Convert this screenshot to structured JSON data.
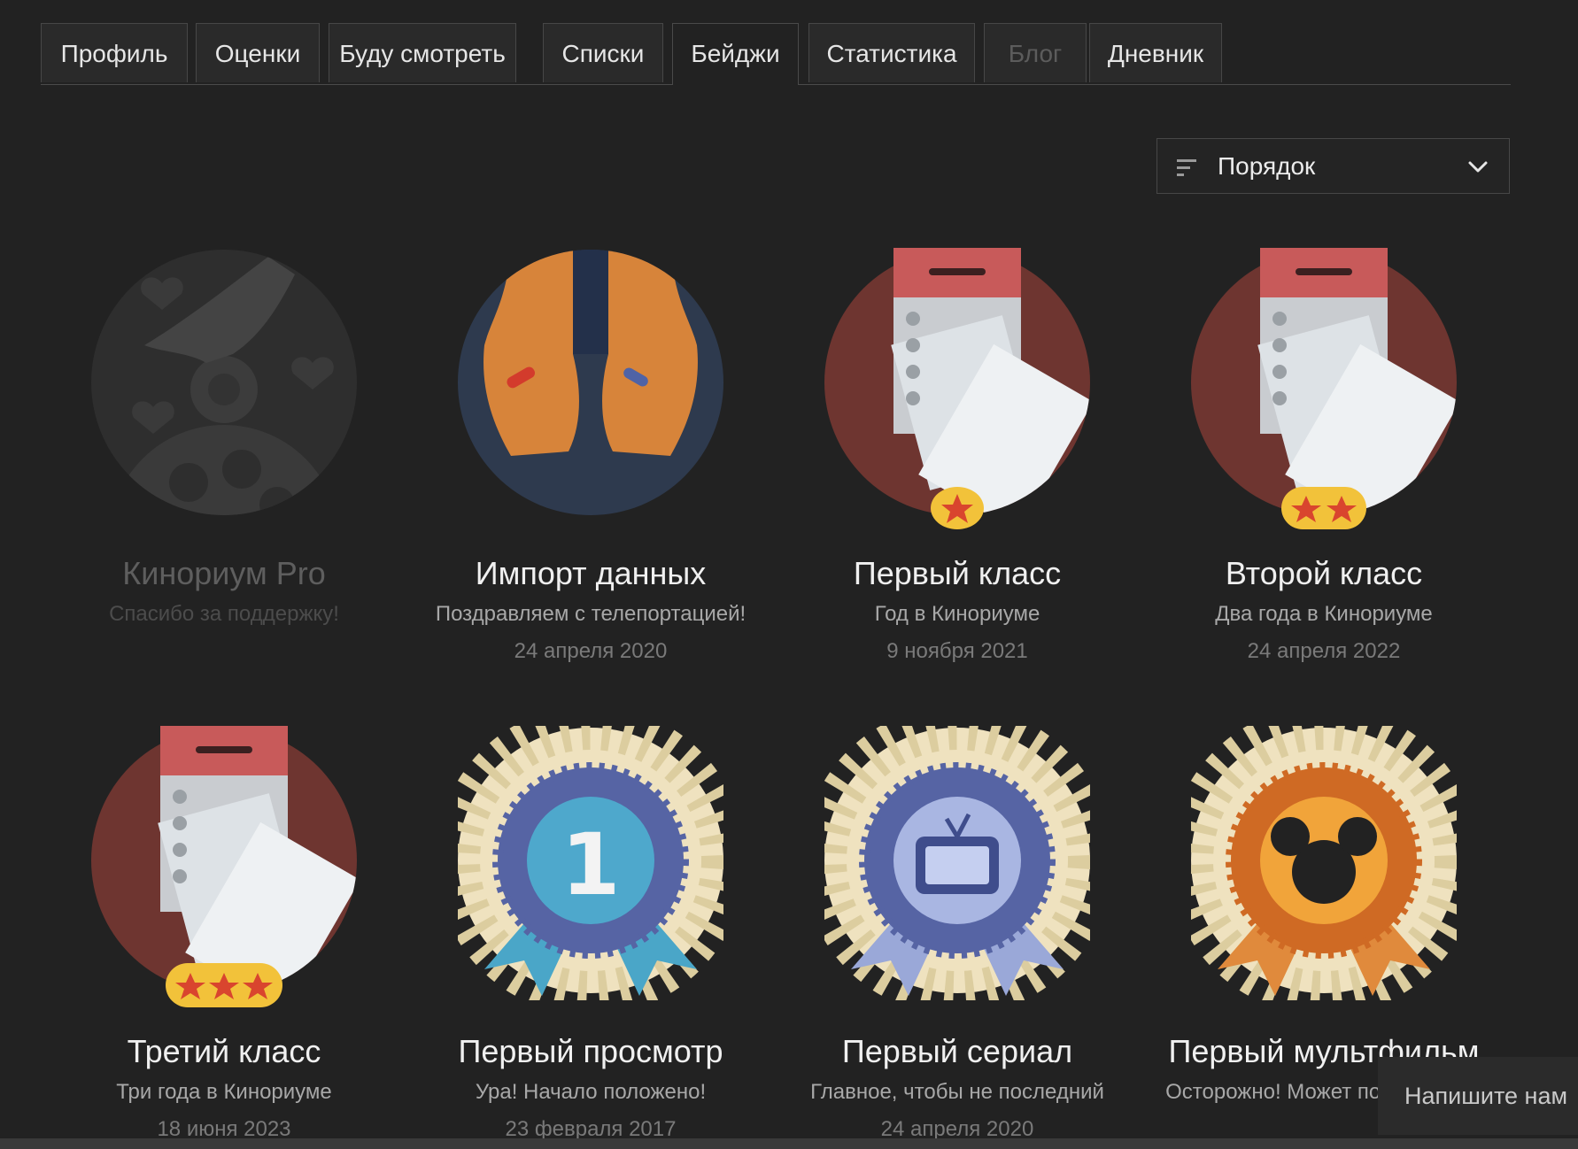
{
  "tabs": [
    {
      "label": "Профиль"
    },
    {
      "label": "Оценки"
    },
    {
      "label": "Буду смотреть"
    },
    {
      "label": "Списки"
    },
    {
      "label": "Бейджи",
      "active": true
    },
    {
      "label": "Статистика"
    },
    {
      "label": "Блог",
      "disabled": true
    },
    {
      "label": "Дневник"
    }
  ],
  "sort": {
    "label": "Порядок",
    "icon": "sort-icon",
    "chevron": "chevron-down-icon"
  },
  "badges": [
    {
      "title": "Кинориум Pro",
      "desc": "Спасибо за поддержку!",
      "date": "",
      "icon": "film-reel-hand-icon",
      "locked": true
    },
    {
      "title": "Импорт данных",
      "desc": "Поздравляем с телепортацией!",
      "date": "24 апреля 2020",
      "icon": "hands-pills-icon"
    },
    {
      "title": "Первый класс",
      "desc": "Год в Кинориуме",
      "date": "9 ноября 2021",
      "icon": "calendar-one-star-icon",
      "stars": 1
    },
    {
      "title": "Второй класс",
      "desc": "Два года в Кинориуме",
      "date": "24 апреля 2022",
      "icon": "calendar-two-stars-icon",
      "stars": 2
    },
    {
      "title": "Третий класс",
      "desc": "Три года в Кинориуме",
      "date": "18 июня 2023",
      "icon": "calendar-three-stars-icon",
      "stars": 3
    },
    {
      "title": "Первый просмотр",
      "desc": "Ура! Начало положено!",
      "date": "23 февраля 2017",
      "icon": "rosette-number-one-icon"
    },
    {
      "title": "Первый сериал",
      "desc": "Главное, чтобы не последний",
      "date": "24 апреля 2020",
      "icon": "rosette-tv-icon"
    },
    {
      "title": "Первый мультфильм",
      "desc": "Осторожно! Может понравиться",
      "date": "",
      "icon": "rosette-mickey-icon"
    }
  ],
  "chat": {
    "label": "Напишите нам"
  },
  "colors": {
    "background": "#222222",
    "calendar_circle": "#6e3530",
    "pills_circle": "#2e3a4e",
    "rosette_blue": "#5664a4",
    "rosette_orange": "#cf6a24"
  }
}
